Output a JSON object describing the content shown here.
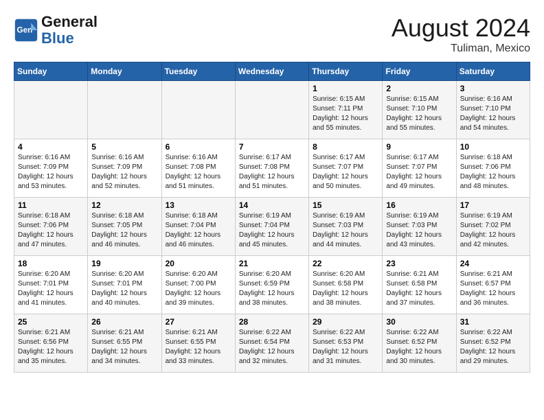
{
  "header": {
    "logo_general": "General",
    "logo_blue": "Blue",
    "month_year": "August 2024",
    "location": "Tuliman, Mexico"
  },
  "days_of_week": [
    "Sunday",
    "Monday",
    "Tuesday",
    "Wednesday",
    "Thursday",
    "Friday",
    "Saturday"
  ],
  "weeks": [
    [
      {
        "day": "",
        "content": ""
      },
      {
        "day": "",
        "content": ""
      },
      {
        "day": "",
        "content": ""
      },
      {
        "day": "",
        "content": ""
      },
      {
        "day": "1",
        "content": "Sunrise: 6:15 AM\nSunset: 7:11 PM\nDaylight: 12 hours\nand 55 minutes."
      },
      {
        "day": "2",
        "content": "Sunrise: 6:15 AM\nSunset: 7:10 PM\nDaylight: 12 hours\nand 55 minutes."
      },
      {
        "day": "3",
        "content": "Sunrise: 6:16 AM\nSunset: 7:10 PM\nDaylight: 12 hours\nand 54 minutes."
      }
    ],
    [
      {
        "day": "4",
        "content": "Sunrise: 6:16 AM\nSunset: 7:09 PM\nDaylight: 12 hours\nand 53 minutes."
      },
      {
        "day": "5",
        "content": "Sunrise: 6:16 AM\nSunset: 7:09 PM\nDaylight: 12 hours\nand 52 minutes."
      },
      {
        "day": "6",
        "content": "Sunrise: 6:16 AM\nSunset: 7:08 PM\nDaylight: 12 hours\nand 51 minutes."
      },
      {
        "day": "7",
        "content": "Sunrise: 6:17 AM\nSunset: 7:08 PM\nDaylight: 12 hours\nand 51 minutes."
      },
      {
        "day": "8",
        "content": "Sunrise: 6:17 AM\nSunset: 7:07 PM\nDaylight: 12 hours\nand 50 minutes."
      },
      {
        "day": "9",
        "content": "Sunrise: 6:17 AM\nSunset: 7:07 PM\nDaylight: 12 hours\nand 49 minutes."
      },
      {
        "day": "10",
        "content": "Sunrise: 6:18 AM\nSunset: 7:06 PM\nDaylight: 12 hours\nand 48 minutes."
      }
    ],
    [
      {
        "day": "11",
        "content": "Sunrise: 6:18 AM\nSunset: 7:06 PM\nDaylight: 12 hours\nand 47 minutes."
      },
      {
        "day": "12",
        "content": "Sunrise: 6:18 AM\nSunset: 7:05 PM\nDaylight: 12 hours\nand 46 minutes."
      },
      {
        "day": "13",
        "content": "Sunrise: 6:18 AM\nSunset: 7:04 PM\nDaylight: 12 hours\nand 46 minutes."
      },
      {
        "day": "14",
        "content": "Sunrise: 6:19 AM\nSunset: 7:04 PM\nDaylight: 12 hours\nand 45 minutes."
      },
      {
        "day": "15",
        "content": "Sunrise: 6:19 AM\nSunset: 7:03 PM\nDaylight: 12 hours\nand 44 minutes."
      },
      {
        "day": "16",
        "content": "Sunrise: 6:19 AM\nSunset: 7:03 PM\nDaylight: 12 hours\nand 43 minutes."
      },
      {
        "day": "17",
        "content": "Sunrise: 6:19 AM\nSunset: 7:02 PM\nDaylight: 12 hours\nand 42 minutes."
      }
    ],
    [
      {
        "day": "18",
        "content": "Sunrise: 6:20 AM\nSunset: 7:01 PM\nDaylight: 12 hours\nand 41 minutes."
      },
      {
        "day": "19",
        "content": "Sunrise: 6:20 AM\nSunset: 7:01 PM\nDaylight: 12 hours\nand 40 minutes."
      },
      {
        "day": "20",
        "content": "Sunrise: 6:20 AM\nSunset: 7:00 PM\nDaylight: 12 hours\nand 39 minutes."
      },
      {
        "day": "21",
        "content": "Sunrise: 6:20 AM\nSunset: 6:59 PM\nDaylight: 12 hours\nand 38 minutes."
      },
      {
        "day": "22",
        "content": "Sunrise: 6:20 AM\nSunset: 6:58 PM\nDaylight: 12 hours\nand 38 minutes."
      },
      {
        "day": "23",
        "content": "Sunrise: 6:21 AM\nSunset: 6:58 PM\nDaylight: 12 hours\nand 37 minutes."
      },
      {
        "day": "24",
        "content": "Sunrise: 6:21 AM\nSunset: 6:57 PM\nDaylight: 12 hours\nand 36 minutes."
      }
    ],
    [
      {
        "day": "25",
        "content": "Sunrise: 6:21 AM\nSunset: 6:56 PM\nDaylight: 12 hours\nand 35 minutes."
      },
      {
        "day": "26",
        "content": "Sunrise: 6:21 AM\nSunset: 6:55 PM\nDaylight: 12 hours\nand 34 minutes."
      },
      {
        "day": "27",
        "content": "Sunrise: 6:21 AM\nSunset: 6:55 PM\nDaylight: 12 hours\nand 33 minutes."
      },
      {
        "day": "28",
        "content": "Sunrise: 6:22 AM\nSunset: 6:54 PM\nDaylight: 12 hours\nand 32 minutes."
      },
      {
        "day": "29",
        "content": "Sunrise: 6:22 AM\nSunset: 6:53 PM\nDaylight: 12 hours\nand 31 minutes."
      },
      {
        "day": "30",
        "content": "Sunrise: 6:22 AM\nSunset: 6:52 PM\nDaylight: 12 hours\nand 30 minutes."
      },
      {
        "day": "31",
        "content": "Sunrise: 6:22 AM\nSunset: 6:52 PM\nDaylight: 12 hours\nand 29 minutes."
      }
    ]
  ]
}
